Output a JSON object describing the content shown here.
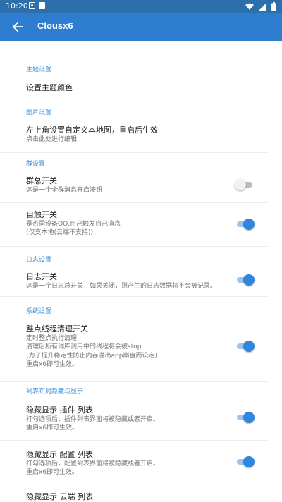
{
  "status_bar": {
    "time": "10:20",
    "notification_icons": [
      "a-icon",
      "square-icon"
    ],
    "system_icons": [
      "wifi-icon",
      "signal-icon",
      "battery-icon"
    ]
  },
  "app_bar": {
    "title": "Clousx6",
    "back_icon": "arrow-back-icon"
  },
  "colors": {
    "status_bar": "#2b6fab",
    "app_bar": "#2e7dd1",
    "accent": "#3d8fd6",
    "switch_on": "#2e86de"
  },
  "sections": [
    {
      "header": "主题设置",
      "items": [
        {
          "title": "设置主题颜色"
        }
      ]
    },
    {
      "header": "图片设置",
      "items": [
        {
          "title": "左上角设置自定义本地图，重启后生效",
          "summary": "点击此处进行编辑"
        }
      ]
    },
    {
      "header": "群设置",
      "items": [
        {
          "title": "群总开关",
          "summary": "这是一个全群消息开启按钮",
          "switch": "off"
        },
        {
          "title": "自触开关",
          "summary": "是否同设备QQ,自己触发自己消息\n(仅支本地(云端不支持))",
          "switch": "on"
        }
      ]
    },
    {
      "header": "日志设置",
      "items": [
        {
          "title": "日志开关",
          "summary": "这是一个日志总开关，如果关闭，则产生的日志数据将不会被记录。",
          "switch": "on"
        }
      ]
    },
    {
      "header": "系统设置",
      "items": [
        {
          "title": "整点线程清理开关",
          "summary": "定时整点执行清理\n清理后所有词库调用中的线程将会被stop\n(为了提升稳定性防止内存溢出app崩盘而设定)\n重启x6即可生效。",
          "switch": "on"
        }
      ]
    },
    {
      "header": "列表布局隐藏与显示",
      "items": [
        {
          "title": "隐藏显示 插件 列表",
          "summary": "打勾选项后，插件列表界面将被隐藏或者开启。\n重启x6即可生效。",
          "switch": "on"
        },
        {
          "title": "隐藏显示 配置 列表",
          "summary": "打勾选项后，配置列表界面将被隐藏或者开启。\n重启x6即可生效。",
          "switch": "on"
        },
        {
          "title": "隐藏显示 云端 列表"
        }
      ]
    }
  ]
}
